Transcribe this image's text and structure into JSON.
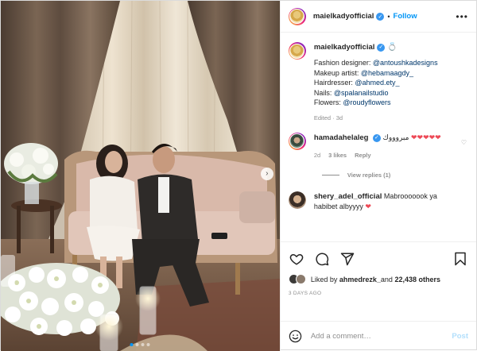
{
  "post": {
    "author": "maielkadyofficial",
    "follow_label": "Follow",
    "more_icon": "more-horizontal-icon"
  },
  "caption": {
    "author": "maielkadyofficial",
    "ring_emoji": "💍",
    "lines": [
      {
        "label": "Fashion designer: ",
        "mention": "@antoushkadesigns"
      },
      {
        "label": "Makeup artist: ",
        "mention": "@hebamaagdy_"
      },
      {
        "label": "Hairdresser: ",
        "mention": "@ahmed.ety_"
      },
      {
        "label": "Nails: ",
        "mention": "@spalanailstudio"
      },
      {
        "label": "Flowers: ",
        "mention": "@roudyflowers"
      }
    ],
    "meta": "Edited · 3d"
  },
  "comments": [
    {
      "author": "hamadahelaleg",
      "text": "مبروووك",
      "hearts": "❤❤❤❤❤",
      "time": "2d",
      "likes": "3 likes",
      "reply_label": "Reply",
      "view_replies": "View replies (1)"
    },
    {
      "author": "shery_adel_official",
      "text": "Mabrooooook ya habibet albyyyy",
      "hearts": "❤"
    }
  ],
  "likes": {
    "liked_by_label": "Liked by ",
    "first_liker": "ahmedrezk_",
    "and_label": " and ",
    "others": "22,438 others"
  },
  "date": "3 DAYS AGO",
  "add_comment": {
    "placeholder": "Add a comment…",
    "post_label": "Post"
  },
  "colors": {
    "accent": "#0095f6",
    "mention": "#00376b",
    "heart": "#ed4956",
    "muted": "#8e8e8e",
    "post_disabled": "#b2dffc"
  }
}
